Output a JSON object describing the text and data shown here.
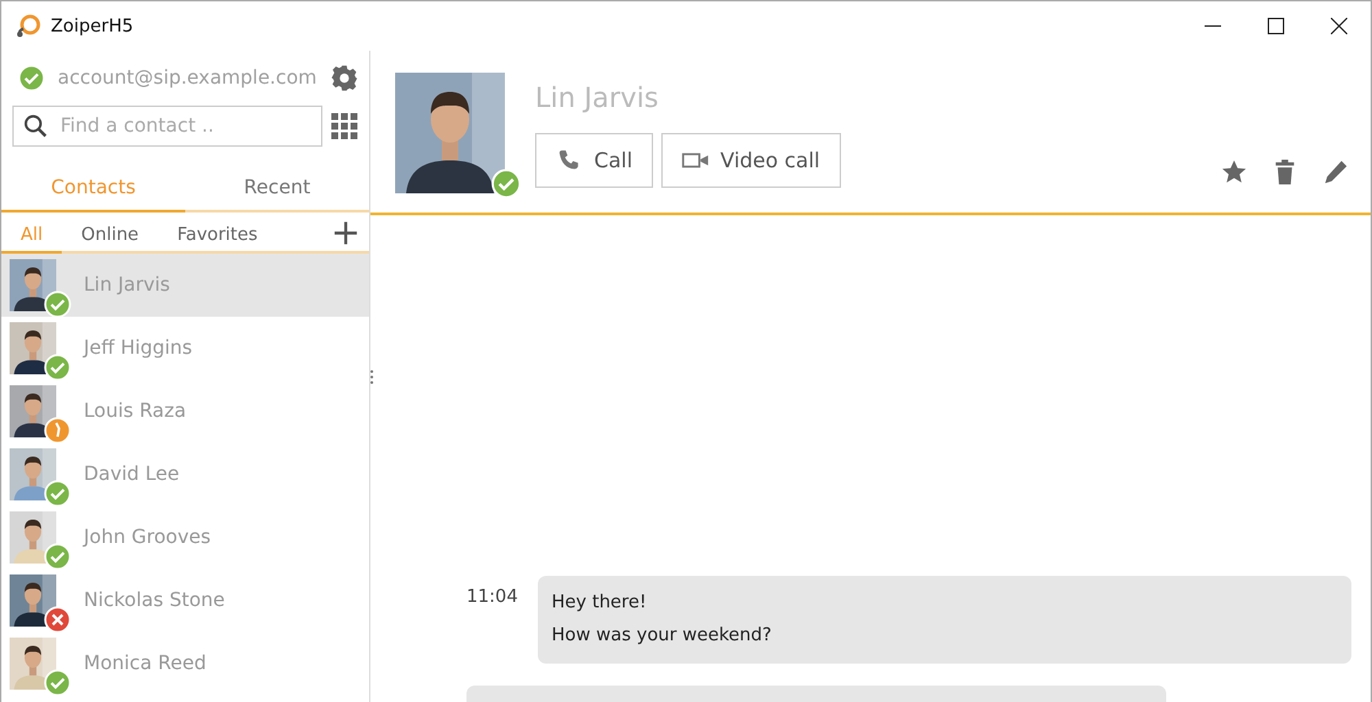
{
  "window": {
    "title": "ZoiperH5"
  },
  "account": {
    "address": "account@sip.example.com",
    "kind": "online",
    "color": "#7ab648"
  },
  "search": {
    "placeholder": "Find a contact .."
  },
  "tabs": [
    {
      "label": "Contacts",
      "selected": true
    },
    {
      "label": "Recent",
      "selected": false
    }
  ],
  "filters": [
    {
      "label": "All",
      "selected": true
    },
    {
      "label": "Online",
      "selected": false
    },
    {
      "label": "Favorites",
      "selected": false
    }
  ],
  "contacts": [
    {
      "name": "Lin Jarvis",
      "kind": "online",
      "color": "#7ab648",
      "selected": true
    },
    {
      "name": "Jeff Higgins",
      "kind": "online",
      "color": "#7ab648",
      "selected": false
    },
    {
      "name": "Louis Raza",
      "kind": "busy",
      "color": "#f0962f",
      "selected": false
    },
    {
      "name": "David Lee",
      "kind": "online",
      "color": "#7ab648",
      "selected": false
    },
    {
      "name": "John Grooves",
      "kind": "online",
      "color": "#7ab648",
      "selected": false
    },
    {
      "name": "Nickolas Stone",
      "kind": "offline",
      "color": "#e0483a",
      "selected": false
    },
    {
      "name": "Monica Reed",
      "kind": "online",
      "color": "#7ab648",
      "selected": false
    }
  ],
  "header": {
    "name": "Lin Jarvis",
    "kind": "online",
    "color": "#7ab648",
    "buttons": [
      {
        "kind": "call",
        "label": "Call"
      },
      {
        "kind": "video",
        "label": "Video call"
      }
    ]
  },
  "messages": [
    {
      "time": "11:04",
      "lines": [
        "Hey there!",
        "How was your weekend?"
      ]
    }
  ]
}
